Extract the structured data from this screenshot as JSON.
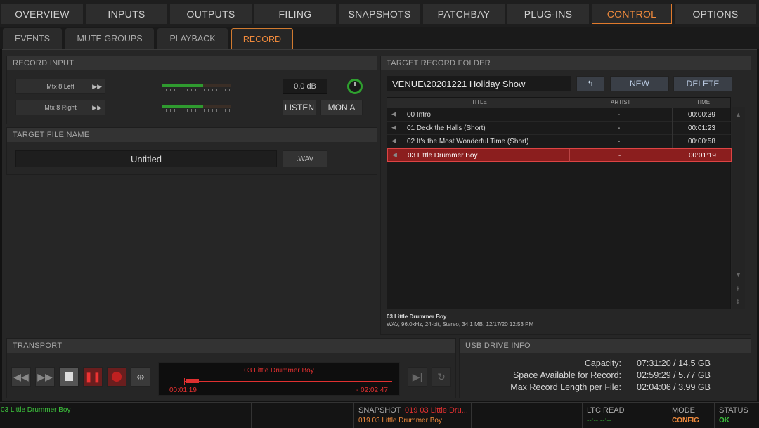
{
  "top_tabs": [
    "OVERVIEW",
    "INPUTS",
    "OUTPUTS",
    "FILING",
    "SNAPSHOTS",
    "PATCHBAY",
    "PLUG-INS",
    "CONTROL",
    "OPTIONS"
  ],
  "active_top_tab": "CONTROL",
  "sub_tabs": [
    "EVENTS",
    "MUTE GROUPS",
    "PLAYBACK",
    "RECORD"
  ],
  "active_sub_tab": "RECORD",
  "record_input": {
    "header": "RECORD INPUT",
    "rows": [
      {
        "label": "Mtx 8 Left",
        "level": 0.6
      },
      {
        "label": "Mtx 8 Right",
        "level": 0.6
      }
    ],
    "gain": "0.0 dB",
    "listen_label": "LISTEN",
    "mon_label": "MON A"
  },
  "target_file": {
    "header": "TARGET FILE NAME",
    "name": "Untitled",
    "format": ".WAV"
  },
  "target_folder": {
    "header": "TARGET RECORD FOLDER",
    "path": "VENUE\\20201221 Holiday Show",
    "new_label": "NEW",
    "delete_label": "DELETE",
    "columns": {
      "title": "TITLE",
      "artist": "ARTIST",
      "time": "TIME"
    },
    "tracks": [
      {
        "title": "00 Intro",
        "artist": "-",
        "time": "00:00:39"
      },
      {
        "title": "01 Deck the Halls (Short)",
        "artist": "-",
        "time": "00:01:23"
      },
      {
        "title": "02 It's the Most Wonderful Time (Short)",
        "artist": "-",
        "time": "00:00:58"
      },
      {
        "title": "03 Little Drummer Boy",
        "artist": "-",
        "time": "00:01:19"
      }
    ],
    "selected_index": 3,
    "info_title": "03 Little Drummer Boy",
    "info_detail": "WAV, 96.0kHz, 24-bit, Stereo, 34.1 MB, 12/17/20 12:53 PM"
  },
  "transport": {
    "header": "TRANSPORT",
    "track": "03 Little Drummer Boy",
    "elapsed": "00:01:19",
    "remaining": "- 02:02:47",
    "progress": 0.01
  },
  "usb": {
    "header": "USB DRIVE INFO",
    "rows": [
      {
        "label": "Capacity:",
        "value": "07:31:20 / 14.5 GB"
      },
      {
        "label": "Space Available for Record:",
        "value": "02:59:29 / 5.77 GB"
      },
      {
        "label": "Max Record Length per File:",
        "value": "02:04:06 / 3.99 GB"
      }
    ]
  },
  "statusbar": {
    "message": "03 Little Drummer Boy",
    "snapshot_label": "SNAPSHOT",
    "snapshot_current": "019 03 Little Dru...",
    "snapshot_next": "019 03 Little Drummer Boy",
    "ltc_label": "LTC READ",
    "ltc_value": "--:--:--:--",
    "mode_label": "MODE",
    "mode_value": "CONFIG",
    "status_label": "STATUS",
    "status_value": "OK"
  },
  "colors": {
    "accent": "#f08a3c",
    "selected_row": "#8b1e1e",
    "ok_green": "#39c439",
    "record_red": "#e03030"
  }
}
